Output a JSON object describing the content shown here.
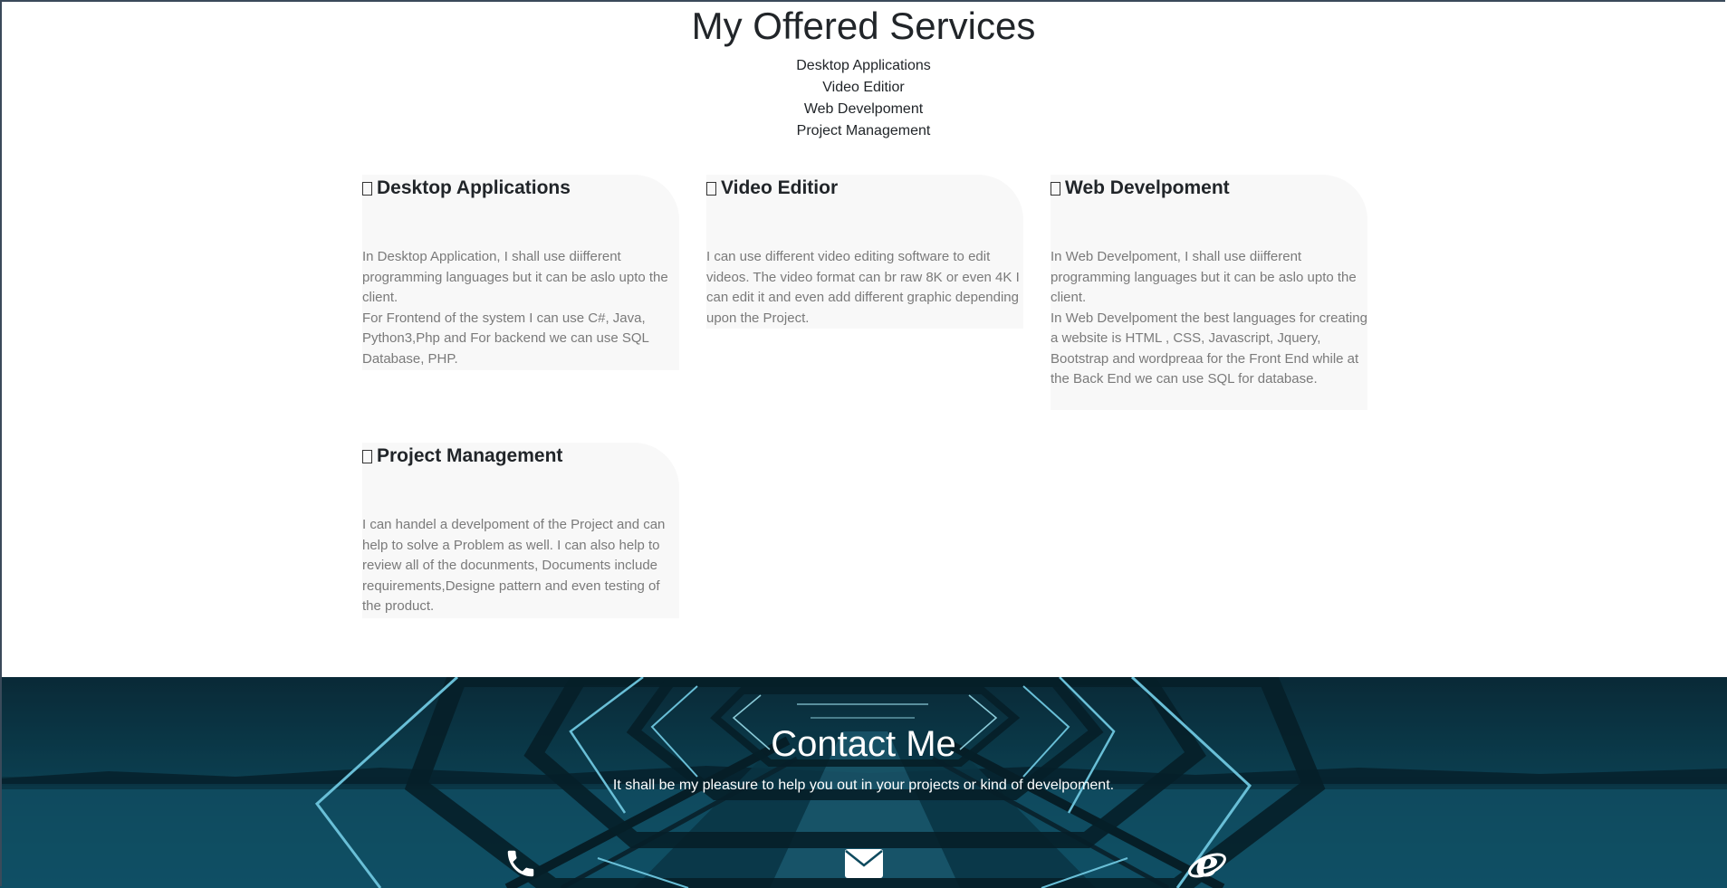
{
  "services": {
    "title": "My Offered Services",
    "list": [
      "Desktop Applications",
      "Video Editior",
      "Web Develpoment",
      "Project Management"
    ],
    "cards": [
      {
        "icon": "square-icon",
        "title": "Desktop Applications",
        "paragraphs": [
          "In Desktop Application, I shall use diifferent programming languages but it can be aslo upto the client.",
          "For Frontend of the system I can use C#, Java, Python3,Php and For backend we can use SQL Database, PHP."
        ]
      },
      {
        "icon": "square-icon",
        "title": "Video Editior",
        "paragraphs": [
          "I can use different video editing software to edit videos. The video format can br raw 8K or even 4K I can edit it and even add different graphic depending upon the Project."
        ]
      },
      {
        "icon": "square-icon",
        "title": "Web Develpoment",
        "paragraphs": [
          "In Web Develpoment, I shall use diifferent programming languages but it can be aslo upto the client.",
          "In Web Develpoment the best languages for creating a website is HTML , CSS, Javascript, Jquery, Bootstrap and wordpreaa for the Front End while at the Back End we can use SQL for database."
        ]
      },
      {
        "icon": "square-icon",
        "title": "Project Management",
        "paragraphs": [
          "I can handel a develpoment of the Project and can help to solve a Problem as well. I can also help to review all of the docunments, Documents include requirements,Designe pattern and even testing of the product."
        ]
      }
    ]
  },
  "contact": {
    "title": "Contact Me",
    "subtitle": "It shall be my pleasure to help you out in your projects or kind of develpoment.",
    "icons": [
      "phone-icon",
      "envelope-icon",
      "internet-explorer-icon"
    ]
  },
  "colors": {
    "card_bg": "#f8f8f8",
    "card_text": "#7a7a7a",
    "contact_bg": "#0e4a5e",
    "neon": "#7fe3ff"
  }
}
